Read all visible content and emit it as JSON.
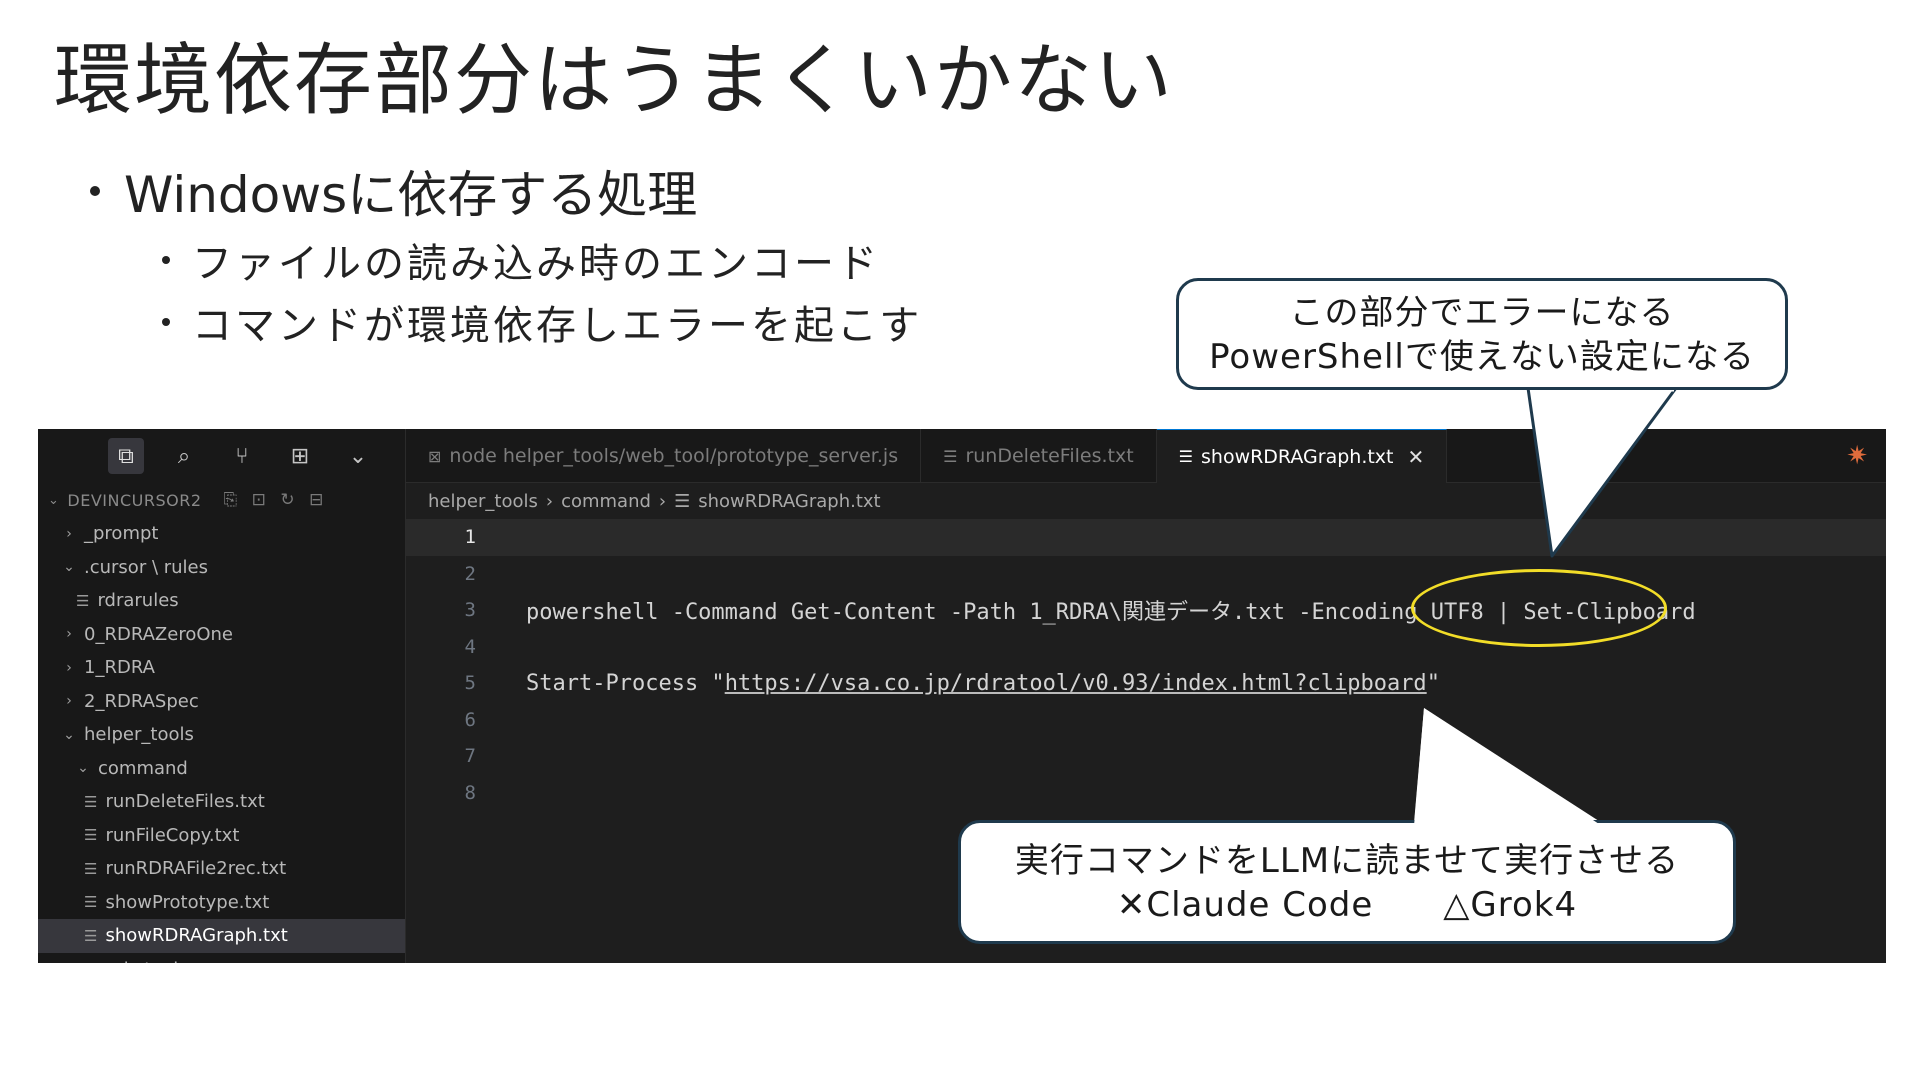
{
  "slide": {
    "title": "環境依存部分はうまくいかない",
    "bullet1": "Windowsに依存する処理",
    "sub1": "ファイルの読み込み時のエンコード",
    "sub2": "コマンドが環境依存しエラーを起こす"
  },
  "callout_top": {
    "line1": "この部分でエラーになる",
    "line2": "PowerShellで使えない設定になる"
  },
  "callout_bottom": {
    "line1": "実行コマンドをLLMに読ませて実行させる",
    "line2": "✕Claude Code　　△Grok4"
  },
  "editor": {
    "explorer_title": "DEVINCURSOR2",
    "tree": [
      {
        "label": "_prompt",
        "arrow": "›"
      },
      {
        "label": ".cursor \\ rules",
        "arrow": "⌄"
      },
      {
        "label": "rdrarules",
        "arrow": ""
      },
      {
        "label": "0_RDRAZeroOne",
        "arrow": "›"
      },
      {
        "label": "1_RDRA",
        "arrow": "›"
      },
      {
        "label": "2_RDRASpec",
        "arrow": "›"
      },
      {
        "label": "helper_tools",
        "arrow": "⌄"
      },
      {
        "label": "command",
        "arrow": "⌄"
      },
      {
        "label": "runDeleteFiles.txt",
        "arrow": ""
      },
      {
        "label": "runFileCopy.txt",
        "arrow": ""
      },
      {
        "label": "runRDRAFile2rec.txt",
        "arrow": ""
      },
      {
        "label": "showPrototype.txt",
        "arrow": ""
      },
      {
        "label": "showRDRAGraph.txt",
        "arrow": ""
      },
      {
        "label": "web_tool",
        "arrow": "›"
      }
    ],
    "tabs": {
      "tab1": "node helper_tools/web_tool/prototype_server.js",
      "tab2": "runDeleteFiles.txt",
      "tab3": "showRDRAGraph.txt"
    },
    "breadcrumb": {
      "part1": "helper_tools",
      "part2": "command",
      "part3": "showRDRAGraph.txt"
    },
    "code": {
      "ln1": "1",
      "ln2": "2",
      "ln3": "3",
      "ln4": "4",
      "ln5": "5",
      "ln6": "6",
      "ln7": "7",
      "ln8": "8",
      "line3": "powershell -Command Get-Content -Path 1_RDRA\\関連データ.txt -Encoding UTF8 | Set-Clipboard",
      "line5_prefix": "Start-Process \"",
      "line5_url": "https://vsa.co.jp/rdratool/v0.93/index.html?clipboard",
      "line5_suffix": "\""
    }
  },
  "colors": {
    "highlight_ellipse": "#f2dd28",
    "callout_border": "#1f3a4d",
    "editor_bg": "#1e1e1e"
  }
}
